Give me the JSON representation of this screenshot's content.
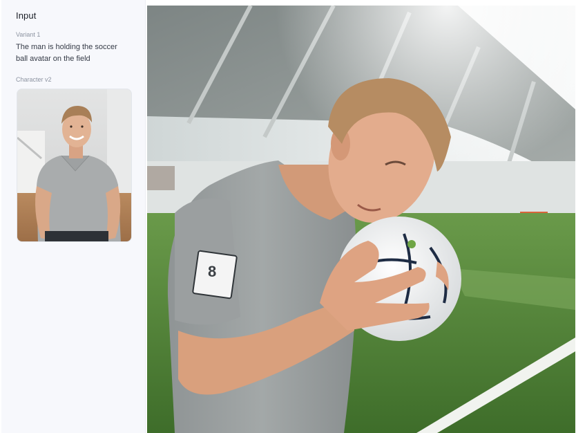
{
  "panel": {
    "title": "Input",
    "variant_label": "Variant 1",
    "prompt": "The man is holding the soccer ball avatar on the field",
    "model_label": "Character v2"
  },
  "images": {
    "reference_thumbnail": "reference-portrait",
    "generated_result": "generated-image"
  },
  "colors": {
    "sidebar_bg": "#f7f8fc",
    "text_primary": "#1b1f27",
    "text_muted": "#8c93a1",
    "pitch_green": "#4e7d35"
  }
}
